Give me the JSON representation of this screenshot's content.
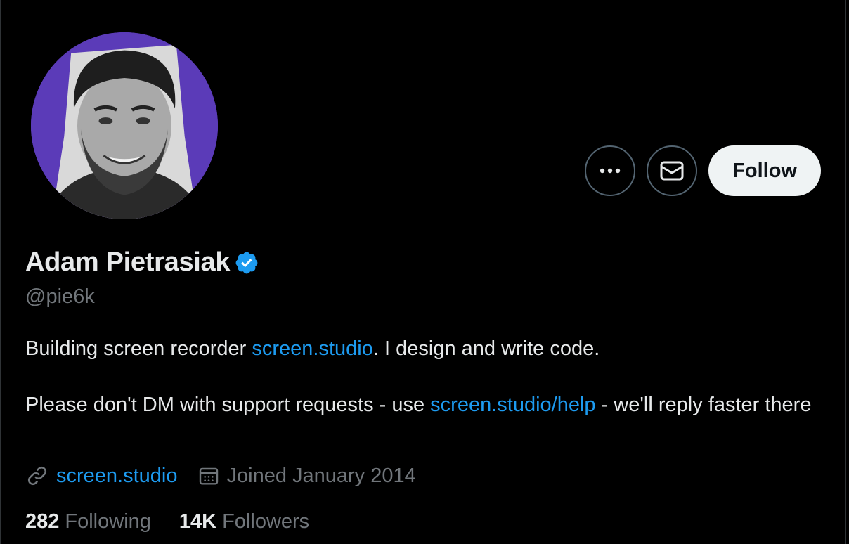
{
  "profile": {
    "display_name": "Adam Pietrasiak",
    "handle": "@pie6k",
    "verified": true,
    "avatar_bg_color": "#5b3bb8"
  },
  "actions": {
    "more_icon": "more-icon",
    "message_icon": "envelope-icon",
    "follow_label": "Follow"
  },
  "bio": {
    "line1_prefix": "Building screen recorder ",
    "line1_link": "screen.studio",
    "line1_suffix": ". I design and write code.",
    "line2_prefix": "Please don't DM with support requests - use ",
    "line2_link": "screen.studio/help",
    "line2_suffix": " - we'll reply faster there"
  },
  "meta": {
    "website": "screen.studio",
    "joined": "Joined January 2014"
  },
  "stats": {
    "following_count": "282",
    "following_label": "Following",
    "followers_count": "14K",
    "followers_label": "Followers"
  },
  "colors": {
    "accent": "#1d9bf0",
    "verified_badge": "#1d9bf0",
    "secondary_text": "#71767b"
  }
}
